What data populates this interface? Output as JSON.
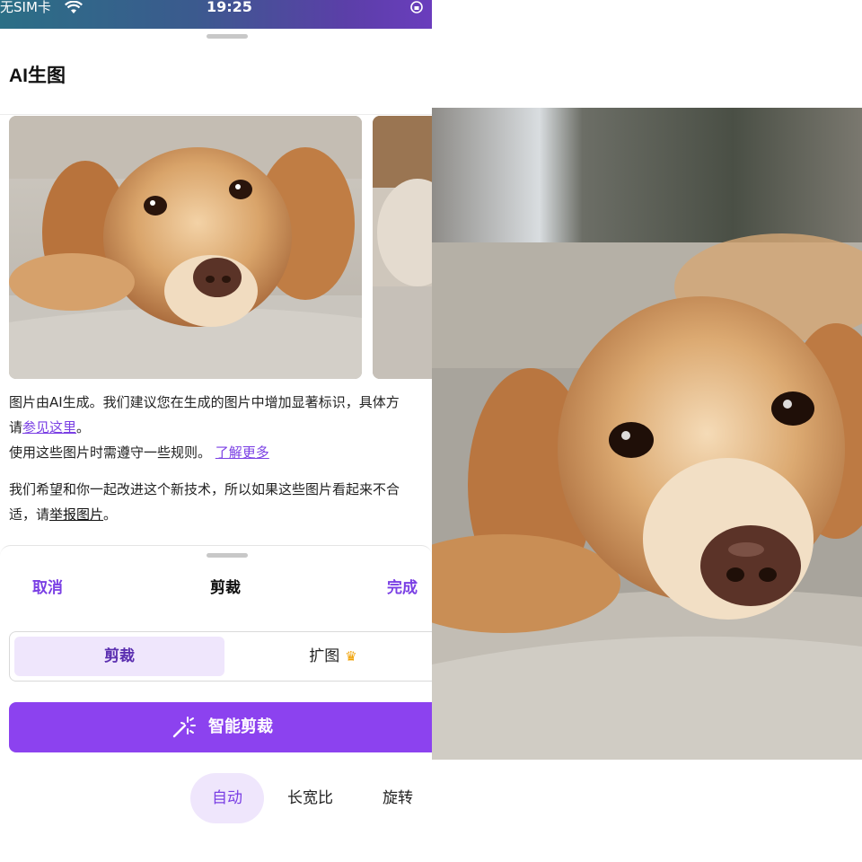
{
  "status_bar": {
    "carrier": "无SIM卡",
    "time": "19:25"
  },
  "header": {
    "title": "AI生图"
  },
  "notice": {
    "line1": "图片由AI生成。我们建议您在生成的图片中增加显著标识，具体方",
    "line2_prefix": "请",
    "line2_link": "参见这里",
    "line2_suffix": "。",
    "line3_text": "使用这些图片时需遵守一些规则。",
    "line3_link": "了解更多",
    "line4": "我们希望和你一起改进这个新技术，所以如果这些图片看起来不合",
    "line5_prefix": "适，请",
    "line5_link": "举报图片",
    "line5_suffix": "。"
  },
  "crop_sheet": {
    "cancel_label": "取消",
    "title": "剪裁",
    "done_label": "完成",
    "segments": {
      "crop_label": "剪裁",
      "expand_label": "扩图",
      "expand_icon": "crown-icon"
    },
    "smart_crop_label": "智能剪裁",
    "tabs": {
      "auto": "自动",
      "ratio": "长宽比",
      "rotate": "旋转"
    }
  },
  "colors": {
    "accent": "#8c42ef",
    "accent_text": "#7a3fe4",
    "accent_light": "#efe6fc"
  }
}
